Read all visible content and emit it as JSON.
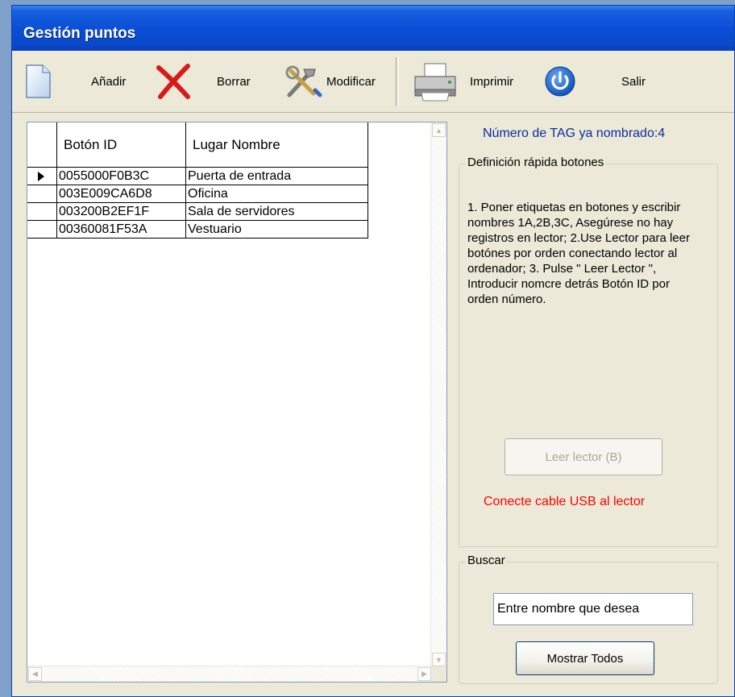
{
  "window": {
    "title": "Gestión puntos"
  },
  "toolbar": {
    "add_label": "Añadir",
    "delete_label": "Borrar",
    "modify_label": "Modificar",
    "print_label": "Imprimir",
    "exit_label": "Salir"
  },
  "grid": {
    "columns": [
      "Botón ID",
      "Lugar Nombre"
    ],
    "rows": [
      {
        "id": "0055000F0B3C",
        "name": "Puerta de entrada"
      },
      {
        "id": "003E009CA6D8",
        "name": "Oficina"
      },
      {
        "id": "003200B2EF1F",
        "name": "Sala de servidores"
      },
      {
        "id": "00360081F53A",
        "name": "Vestuario"
      }
    ]
  },
  "panel": {
    "tag_count": "Número de TAG ya nombrado:4",
    "quick_def_legend": "Definición rápida botones",
    "instructions": "1. Poner etiquetas en botones y escribir nombres 1A,2B,3C, Asegúrese no hay registros en lector; 2.Use Lector para leer botónes por orden conectando lector al ordenador; 3. Pulse \" Leer Lector \", Introducir nomcre detrás Botón ID por orden número.",
    "read_button_label": "Leer lector (B)",
    "usb_warning": "Conecte cable USB al lector",
    "search_legend": "Buscar",
    "search_value": "Entre nombre que desea",
    "show_all_label": "Mostrar Todos"
  },
  "colors": {
    "titlebar": "#0a4fd6",
    "window_bg": "#ece9d8",
    "tag_count_text": "#0a2e9e",
    "warning_text": "#ff0000",
    "disabled_text": "#aca899"
  },
  "icons": {
    "add": "new-document-icon",
    "delete": "red-x-icon",
    "modify": "tools-icon",
    "print": "printer-icon",
    "exit": "power-icon"
  }
}
